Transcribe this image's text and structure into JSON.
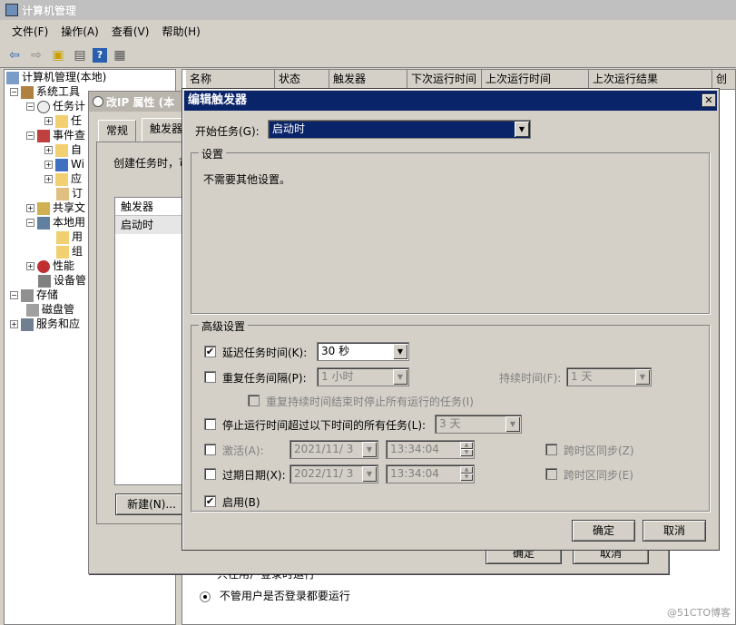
{
  "app": {
    "title": "计算机管理"
  },
  "menu": [
    "文件(F)",
    "操作(A)",
    "查看(V)",
    "帮助(H)"
  ],
  "toolbar_icons": [
    "back-arrow-icon",
    "forward-arrow-icon",
    "up-folder-icon",
    "console-tree-icon",
    "help-icon",
    "properties-icon"
  ],
  "tree": [
    {
      "label": "计算机管理(本地)",
      "expander": ""
    },
    {
      "label": "系统工具",
      "expander": "−"
    },
    {
      "label": "任务计",
      "expander": "−"
    },
    {
      "label": "任",
      "expander": "+"
    },
    {
      "label": "事件查",
      "expander": "−"
    },
    {
      "label": "自",
      "expander": "+"
    },
    {
      "label": "Wi",
      "expander": "+"
    },
    {
      "label": "应",
      "expander": "+"
    },
    {
      "label": "订",
      "expander": ""
    },
    {
      "label": "共享文",
      "expander": "+"
    },
    {
      "label": "本地用",
      "expander": "−"
    },
    {
      "label": "用",
      "expander": ""
    },
    {
      "label": "组",
      "expander": ""
    },
    {
      "label": "性能",
      "expander": "+"
    },
    {
      "label": "设备管",
      "expander": ""
    },
    {
      "label": "存储",
      "expander": "−"
    },
    {
      "label": "磁盘管",
      "expander": ""
    },
    {
      "label": "服务和应",
      "expander": "+"
    }
  ],
  "list_columns": [
    "名称",
    "状态",
    "触发器",
    "下次运行时间",
    "上次运行时间",
    "上次运行结果",
    "创"
  ],
  "props_dialog": {
    "title": "改IP 属性 (本",
    "tabs": [
      "常规",
      "触发器"
    ],
    "desc": "创建任务时，可",
    "table_header": "触发器",
    "table_row": "启动时",
    "new_button": "新建(N)...",
    "ok_button": "确定",
    "cancel_button": "取消",
    "radio_partial": "只在用户登录时运行",
    "radio_label": "不管用户是否登录都要运行"
  },
  "edit_dialog": {
    "title": "编辑触发器",
    "close": "✕",
    "begin_task_label": "开始任务(G):",
    "begin_task_value": "启动时",
    "settings_group": "设置",
    "settings_text": "不需要其他设置。",
    "advanced_group": "高级设置",
    "delay_label": "延迟任务时间(K):",
    "delay_value": "30 秒",
    "delay_checked": true,
    "repeat_label": "重复任务间隔(P):",
    "repeat_value": "1 小时",
    "duration_label": "持续时间(F):",
    "duration_value": "1 天",
    "stop_repeat_label": "重复持续时间结束时停止所有运行的任务(I)",
    "stop_label": "停止运行时间超过以下时间的所有任务(L):",
    "stop_value": "3 天",
    "activate_label": "激活(A):",
    "activate_date": "2021/11/ 3",
    "activate_time": "13:34:04",
    "activate_sync": "跨时区同步(Z)",
    "expire_label": "过期日期(X):",
    "expire_date": "2022/11/ 3",
    "expire_time": "13:34:04",
    "expire_sync": "跨时区同步(E)",
    "enabled_label": "启用(B)",
    "enabled_checked": true,
    "ok_button": "确定",
    "cancel_button": "取消"
  },
  "watermark": "@51CTO博客"
}
